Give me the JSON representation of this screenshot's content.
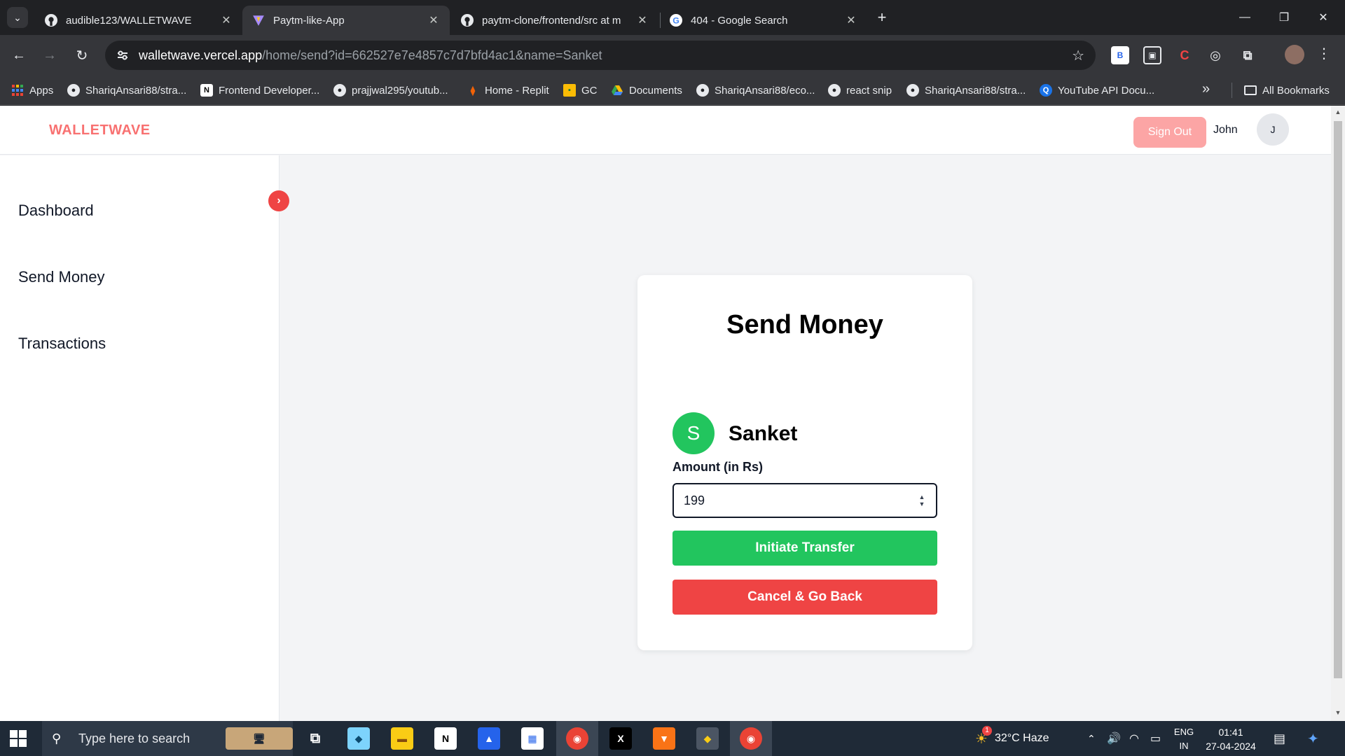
{
  "browser": {
    "tabs": [
      {
        "title": "audible123/WALLETWAVE",
        "icon": "github-icon",
        "active": false
      },
      {
        "title": "Paytm-like-App",
        "icon": "vite-icon",
        "active": true
      },
      {
        "title": "paytm-clone/frontend/src at m",
        "icon": "github-icon",
        "active": false
      },
      {
        "title": "404 - Google Search",
        "icon": "google-icon",
        "active": false
      }
    ],
    "url_host": "walletwave.vercel.app",
    "url_path": "/home/send?id=662527e7e4857c7d7bfd4ac1&name=Sanket",
    "bookmarks": [
      {
        "label": "Apps"
      },
      {
        "label": "ShariqAnsari88/stra..."
      },
      {
        "label": "Frontend Developer..."
      },
      {
        "label": "prajjwal295/youtub..."
      },
      {
        "label": "Home - Replit"
      },
      {
        "label": "GC"
      },
      {
        "label": "Documents"
      },
      {
        "label": "ShariqAnsari88/eco..."
      },
      {
        "label": "react snip"
      },
      {
        "label": "ShariqAnsari88/stra..."
      },
      {
        "label": "YouTube API Docu..."
      }
    ],
    "all_bookmarks": "All Bookmarks"
  },
  "app": {
    "brand": "WALLETWAVE",
    "header": {
      "signout_label": "Sign Out",
      "username": "John",
      "avatar_initial": "J"
    },
    "sidebar": {
      "items": [
        {
          "label": "Dashboard"
        },
        {
          "label": "Send Money"
        },
        {
          "label": "Transactions"
        }
      ]
    },
    "send_card": {
      "title": "Send Money",
      "recipient_initial": "S",
      "recipient_name": "Sanket",
      "amount_label": "Amount (in Rs)",
      "amount_value": "199",
      "initiate_label": "Initiate Transfer",
      "cancel_label": "Cancel & Go Back"
    },
    "colors": {
      "brand": "#f87171",
      "green": "#22c55e",
      "red": "#ef4444",
      "signout": "#fca5a5"
    }
  },
  "taskbar": {
    "search_placeholder": "Type here to search",
    "weather": "32°C  Haze",
    "weather_badge": "1",
    "lang_top": "ENG",
    "lang_bottom": "IN",
    "time": "01:41",
    "date": "27-04-2024"
  }
}
